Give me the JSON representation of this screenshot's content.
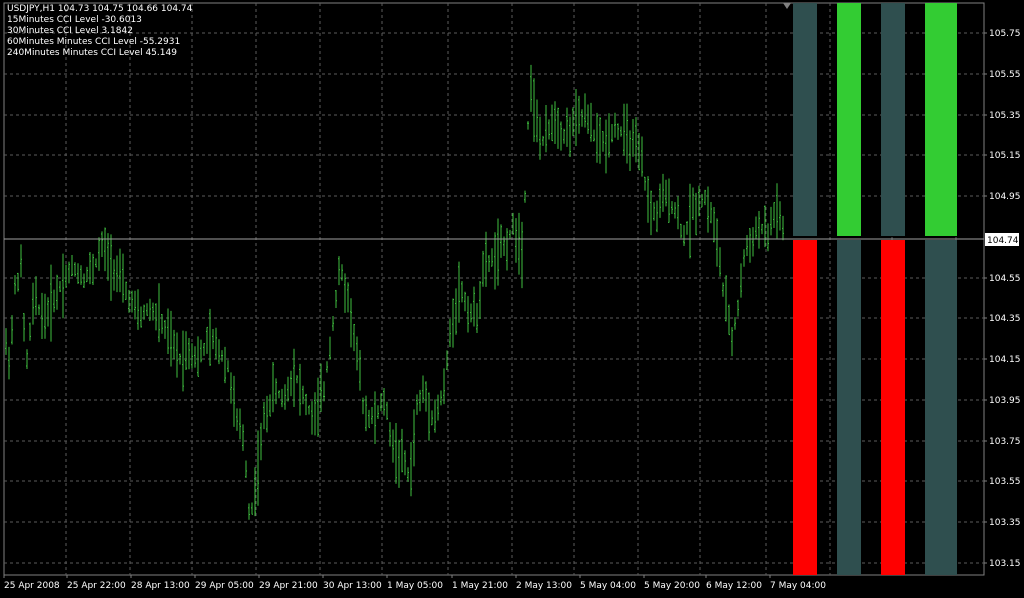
{
  "header": {
    "symbol_line": "USDJPY,H1  104.73 104.75 104.66 104.74",
    "cci_lines": [
      "15Minutes CCI Level -30.6013",
      "30Minutes CCI Level 3.1842",
      "60Minutes Minutes CCI Level -55.2931",
      "240Minutes Minutes CCI Level 45.149"
    ]
  },
  "colors": {
    "background": "#000000",
    "grid": "#5b5b5b",
    "candles": "#3fbf3f",
    "axis_text": "#ffffff",
    "bar_up": "#33cc33",
    "bar_down": "#ff0000",
    "bar_neutral": "#2f4f4f",
    "price_line": "#a0a0a0",
    "price_label_bg": "#ffffff",
    "price_label_text": "#000000"
  },
  "chart_data": {
    "type": "candlestick-bars",
    "symbol": "USDJPY",
    "timeframe": "H1",
    "current_price": "104.74",
    "ylim": [
      103.1,
      105.85
    ],
    "y_ticks": [
      "105.75",
      "105.55",
      "105.35",
      "105.15",
      "104.95",
      "104.74",
      "104.55",
      "104.35",
      "104.15",
      "103.95",
      "103.75",
      "103.55",
      "103.35",
      "103.15"
    ],
    "x_ticks": [
      "25 Apr 2008",
      "25 Apr 22:00",
      "28 Apr 13:00",
      "29 Apr 05:00",
      "29 Apr 21:00",
      "30 Apr 13:00",
      "1 May 05:00",
      "1 May 21:00",
      "2 May 13:00",
      "5 May 04:00",
      "5 May 20:00",
      "6 May 12:00",
      "7 May 04:00"
    ],
    "price_path": [
      [
        0,
        104.25
      ],
      [
        6,
        104.15
      ],
      [
        11,
        104.5
      ],
      [
        17,
        104.6
      ],
      [
        22,
        104.1
      ],
      [
        30,
        104.45
      ],
      [
        40,
        104.35
      ],
      [
        50,
        104.45
      ],
      [
        60,
        104.55
      ],
      [
        70,
        104.6
      ],
      [
        80,
        104.55
      ],
      [
        90,
        104.6
      ],
      [
        98,
        104.7
      ],
      [
        105,
        104.65
      ],
      [
        115,
        104.55
      ],
      [
        125,
        104.45
      ],
      [
        135,
        104.35
      ],
      [
        145,
        104.4
      ],
      [
        155,
        104.35
      ],
      [
        165,
        104.25
      ],
      [
        175,
        104.15
      ],
      [
        185,
        104.2
      ],
      [
        195,
        104.15
      ],
      [
        205,
        104.25
      ],
      [
        215,
        104.2
      ],
      [
        225,
        104.1
      ],
      [
        232,
        103.85
      ],
      [
        240,
        103.75
      ],
      [
        246,
        103.35
      ],
      [
        252,
        103.55
      ],
      [
        260,
        103.85
      ],
      [
        270,
        104.0
      ],
      [
        280,
        103.95
      ],
      [
        290,
        104.1
      ],
      [
        300,
        103.95
      ],
      [
        310,
        103.85
      ],
      [
        320,
        104.0
      ],
      [
        328,
        104.3
      ],
      [
        336,
        104.6
      ],
      [
        344,
        104.45
      ],
      [
        352,
        104.2
      ],
      [
        360,
        103.9
      ],
      [
        370,
        103.85
      ],
      [
        380,
        103.95
      ],
      [
        390,
        103.7
      ],
      [
        400,
        103.65
      ],
      [
        406,
        103.55
      ],
      [
        412,
        103.9
      ],
      [
        420,
        104.0
      ],
      [
        430,
        103.85
      ],
      [
        440,
        104.0
      ],
      [
        448,
        104.35
      ],
      [
        456,
        104.5
      ],
      [
        464,
        104.4
      ],
      [
        472,
        104.35
      ],
      [
        480,
        104.6
      ],
      [
        490,
        104.65
      ],
      [
        500,
        104.7
      ],
      [
        510,
        104.8
      ],
      [
        518,
        104.7
      ],
      [
        522,
        105.05
      ],
      [
        526,
        105.55
      ],
      [
        532,
        105.3
      ],
      [
        540,
        105.2
      ],
      [
        550,
        105.35
      ],
      [
        560,
        105.25
      ],
      [
        570,
        105.3
      ],
      [
        580,
        105.35
      ],
      [
        590,
        105.25
      ],
      [
        600,
        105.2
      ],
      [
        610,
        105.3
      ],
      [
        620,
        105.25
      ],
      [
        630,
        105.2
      ],
      [
        638,
        105.1
      ],
      [
        645,
        104.9
      ],
      [
        652,
        104.85
      ],
      [
        660,
        104.95
      ],
      [
        670,
        104.9
      ],
      [
        680,
        104.75
      ],
      [
        690,
        104.9
      ],
      [
        700,
        104.95
      ],
      [
        708,
        104.85
      ],
      [
        714,
        104.7
      ],
      [
        720,
        104.45
      ],
      [
        728,
        104.25
      ],
      [
        734,
        104.4
      ],
      [
        740,
        104.65
      ],
      [
        748,
        104.75
      ],
      [
        756,
        104.8
      ],
      [
        764,
        104.75
      ],
      [
        772,
        104.9
      ],
      [
        778,
        104.8
      ],
      [
        784,
        104.7
      ]
    ],
    "cci_bars": [
      {
        "label": "15Minutes",
        "value": -30.6013,
        "state": "neutral_up_red_down"
      },
      {
        "label": "30Minutes",
        "value": 3.1842,
        "state": "green_up_neutral_down"
      },
      {
        "label": "60Minutes",
        "value": -55.2931,
        "state": "neutral_up_red_down"
      },
      {
        "label": "240Minutes",
        "value": 45.149,
        "state": "green_up_neutral_down"
      }
    ],
    "grid": true
  }
}
